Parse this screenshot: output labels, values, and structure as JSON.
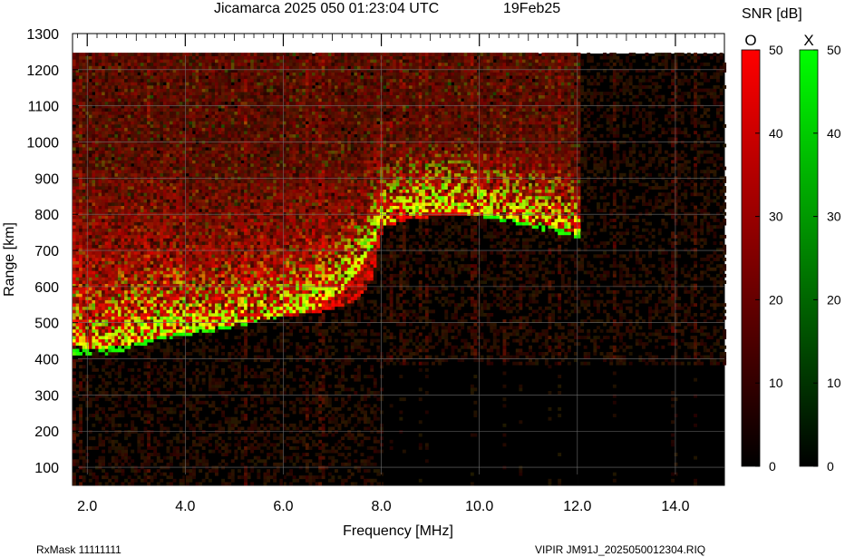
{
  "header": {
    "station": "Jicamarca",
    "year": "2025",
    "doy": "050",
    "time_ut": "01:23:04 UTC",
    "date": "19Feb25"
  },
  "footer": {
    "rx_mask": "RxMask 11111111",
    "file_info": "VIPIR  JM91J_2025050012304.RIQ"
  },
  "chart_data": {
    "type": "heatmap",
    "title": "Jicamarca 2025 050 01:23:04 UTC",
    "xlabel": "Frequency [MHz]",
    "ylabel": "Range [km]",
    "xlim": [
      1.7,
      15.0
    ],
    "ylim": [
      50,
      1300
    ],
    "xticks": [
      2.0,
      4.0,
      6.0,
      8.0,
      10.0,
      12.0,
      14.0
    ],
    "xtick_labels": [
      "2.0",
      "4.0",
      "6.0",
      "8.0",
      "10.0",
      "12.0",
      "14.0"
    ],
    "yticks": [
      100,
      200,
      300,
      400,
      500,
      600,
      700,
      800,
      900,
      1000,
      1100,
      1200,
      1300
    ],
    "ytick_labels": [
      "100",
      "200",
      "300",
      "400",
      "500",
      "600",
      "700",
      "800",
      "900",
      "1000",
      "1100",
      "1200",
      "1300"
    ],
    "data_range_top_km": 1240,
    "grid": true,
    "background": "#000000",
    "colorbar_label": "SNR [dB]",
    "colorbars": [
      {
        "name": "O",
        "min": 0,
        "max": 50,
        "ticks": [
          0,
          10,
          20,
          30,
          40,
          50
        ],
        "color_low": "#000000",
        "color_high": "#ff0000"
      },
      {
        "name": "X",
        "min": 0,
        "max": 50,
        "ticks": [
          0,
          10,
          20,
          30,
          40,
          50
        ],
        "color_low": "#000000",
        "color_high": "#00ff00"
      }
    ],
    "traces": [
      {
        "name": "O",
        "description": "ordinary-mode echo region",
        "points_mhz_km": [
          [
            1.8,
            430
          ],
          [
            2.0,
            420
          ],
          [
            2.5,
            430
          ],
          [
            3.0,
            440
          ],
          [
            3.5,
            460
          ],
          [
            4.0,
            470
          ],
          [
            4.5,
            480
          ],
          [
            5.0,
            490
          ],
          [
            5.5,
            505
          ],
          [
            6.0,
            515
          ],
          [
            6.5,
            520
          ],
          [
            7.0,
            535
          ],
          [
            7.5,
            560
          ],
          [
            7.8,
            620
          ],
          [
            8.0,
            760
          ],
          [
            8.5,
            780
          ],
          [
            9.0,
            790
          ],
          [
            9.5,
            795
          ],
          [
            10.0,
            795
          ],
          [
            10.5,
            785
          ],
          [
            11.0,
            770
          ],
          [
            11.5,
            760
          ],
          [
            12.0,
            740
          ]
        ]
      },
      {
        "name": "X",
        "description": "extraordinary-mode echo region",
        "points_mhz_km": [
          [
            1.8,
            410
          ],
          [
            2.0,
            400
          ],
          [
            2.5,
            410
          ],
          [
            3.0,
            430
          ],
          [
            3.5,
            450
          ],
          [
            4.0,
            460
          ],
          [
            4.5,
            470
          ],
          [
            5.0,
            485
          ],
          [
            5.5,
            500
          ],
          [
            6.0,
            515
          ],
          [
            6.5,
            530
          ],
          [
            7.0,
            560
          ],
          [
            7.5,
            640
          ],
          [
            8.0,
            760
          ],
          [
            8.5,
            790
          ],
          [
            9.0,
            800
          ],
          [
            9.5,
            800
          ],
          [
            10.0,
            790
          ],
          [
            10.5,
            775
          ],
          [
            11.0,
            760
          ],
          [
            11.5,
            745
          ],
          [
            12.0,
            730
          ]
        ]
      }
    ]
  }
}
